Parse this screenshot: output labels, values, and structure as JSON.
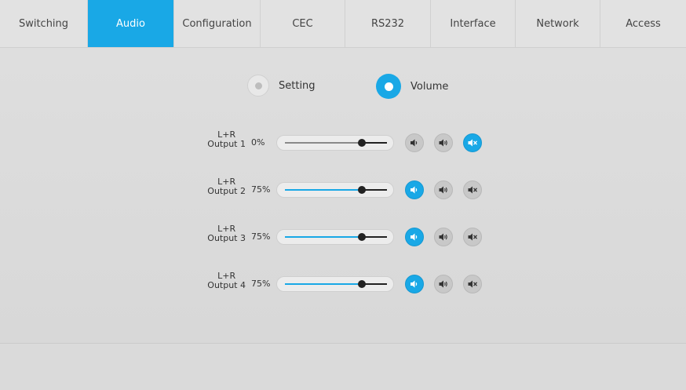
{
  "tabs": [
    {
      "label": "Switching"
    },
    {
      "label": "Audio"
    },
    {
      "label": "Configuration"
    },
    {
      "label": "CEC"
    },
    {
      "label": "RS232"
    },
    {
      "label": "Interface"
    },
    {
      "label": "Network"
    },
    {
      "label": "Access"
    }
  ],
  "active_tab": "Audio",
  "mode": {
    "setting_label": "Setting",
    "volume_label": "Volume",
    "selected": "Volume"
  },
  "outputs": [
    {
      "line1": "L+R",
      "line2": "Output 1",
      "percent": "0%",
      "level": 0.75,
      "active_button": "mute"
    },
    {
      "line1": "L+R",
      "line2": "Output 2",
      "percent": "75%",
      "level": 0.75,
      "active_button": "volume-down"
    },
    {
      "line1": "L+R",
      "line2": "Output 3",
      "percent": "75%",
      "level": 0.75,
      "active_button": "volume-down"
    },
    {
      "line1": "L+R",
      "line2": "Output 4",
      "percent": "75%",
      "level": 0.75,
      "active_button": "volume-down"
    }
  ],
  "colors": {
    "accent": "#19a8e6",
    "inactive": "#c8c8c8"
  },
  "icons": {
    "volume_down": "speaker-low-icon",
    "volume_up": "speaker-high-icon",
    "mute": "speaker-mute-icon"
  }
}
